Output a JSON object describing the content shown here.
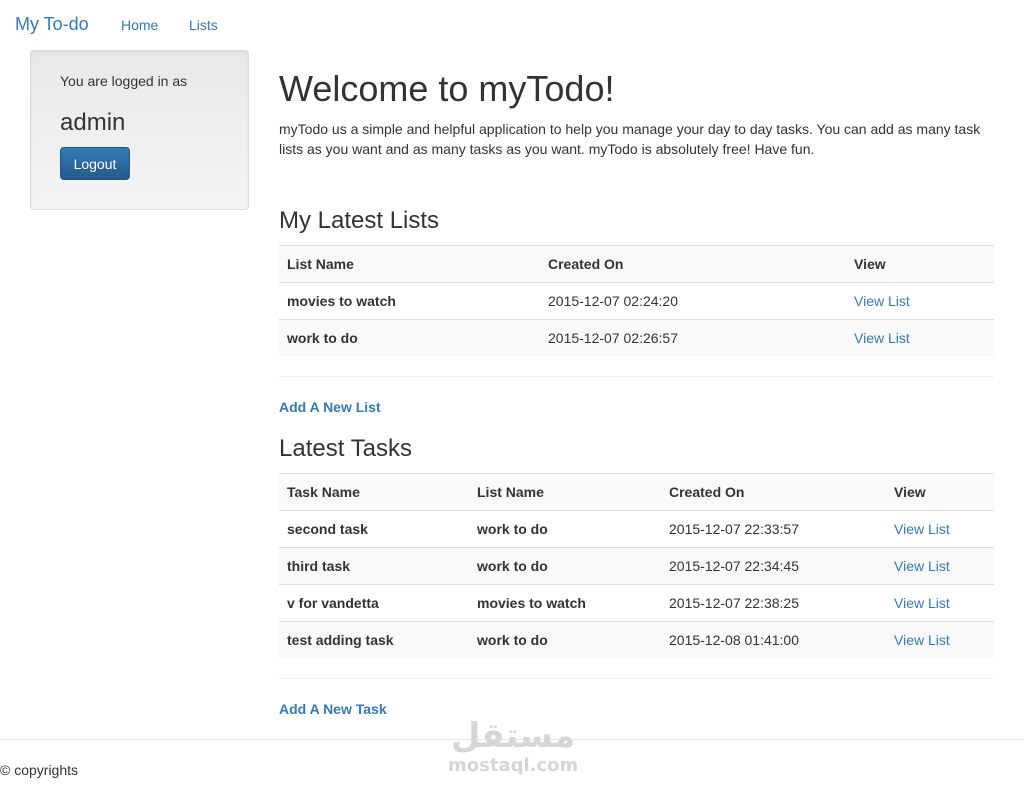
{
  "navbar": {
    "brand": "My To-do",
    "links": [
      "Home",
      "Lists"
    ]
  },
  "sidebar": {
    "logged_in_text": "You are logged in as",
    "username": "admin",
    "logout_label": "Logout"
  },
  "main": {
    "title": "Welcome to myTodo!",
    "intro": "myTodo us a simple and helpful application to help you manage your day to day tasks. You can add as many task lists as you want and as many tasks as you want. myTodo is absolutely free! Have fun.",
    "lists_section": {
      "title": "My Latest Lists",
      "headers": [
        "List Name",
        "Created On",
        "View"
      ],
      "rows": [
        {
          "name": "movies to watch",
          "created": "2015-12-07 02:24:20",
          "view": "View List"
        },
        {
          "name": "work to do",
          "created": "2015-12-07 02:26:57",
          "view": "View List"
        }
      ],
      "add_label": "Add A New List"
    },
    "tasks_section": {
      "title": "Latest Tasks",
      "headers": [
        "Task Name",
        "List Name",
        "Created On",
        "View"
      ],
      "rows": [
        {
          "task": "second task",
          "list": "work to do",
          "created": "2015-12-07 22:33:57",
          "view": "View List"
        },
        {
          "task": "third task",
          "list": "work to do",
          "created": "2015-12-07 22:34:45",
          "view": "View List"
        },
        {
          "task": "v for vandetta",
          "list": "movies to watch",
          "created": "2015-12-07 22:38:25",
          "view": "View List"
        },
        {
          "task": "test adding task",
          "list": "work to do",
          "created": "2015-12-08 01:41:00",
          "view": "View List"
        }
      ],
      "add_label": "Add A New Task"
    }
  },
  "footer": {
    "copyright": "© copyrights"
  },
  "watermark": {
    "logo": "مستقل",
    "text": "mostaql.com"
  },
  "colors": {
    "link": "#337ab7",
    "button": "#265a88",
    "text": "#333333",
    "stripe": "#f9f9f9"
  }
}
